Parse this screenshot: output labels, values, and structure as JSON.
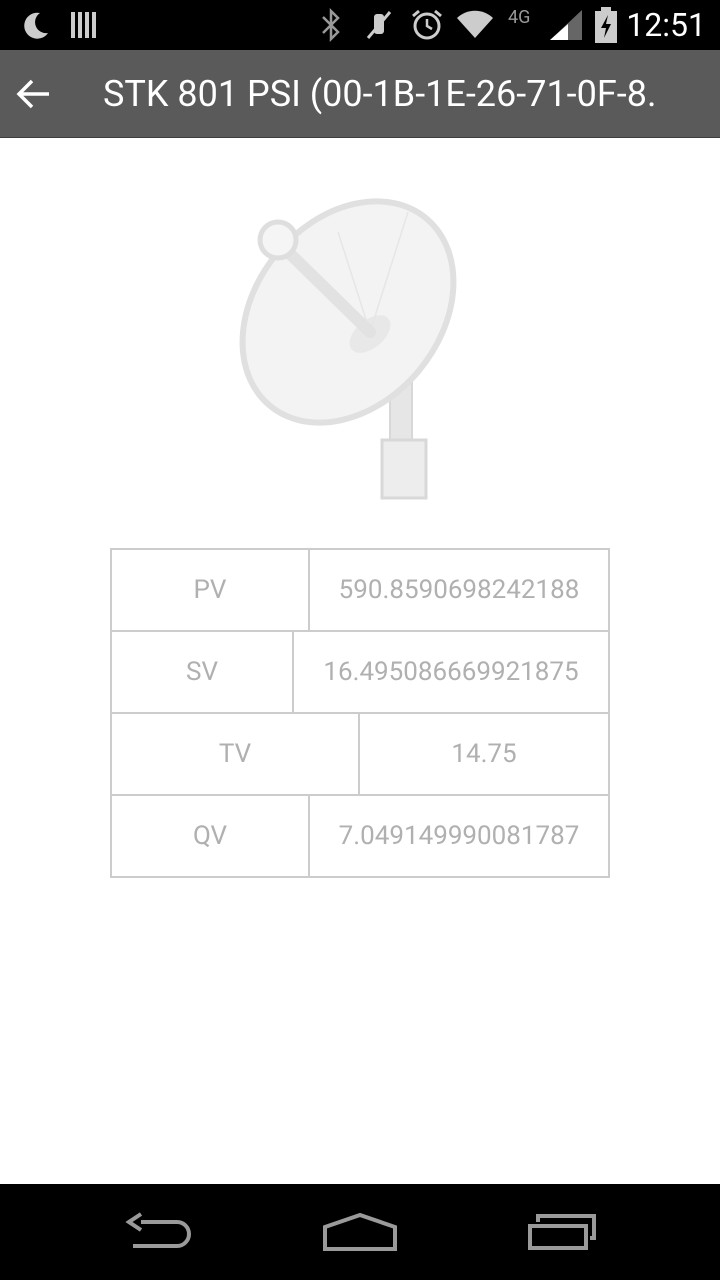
{
  "status_bar": {
    "time": "12:51",
    "network": "4G",
    "icons": [
      "moon-icon",
      "barcode-icon",
      "bluetooth-icon",
      "mute-icon",
      "alarm-icon",
      "wifi-icon",
      "signal-icon",
      "battery-charging-icon"
    ]
  },
  "action_bar": {
    "title": "STK 801 PSI (00-1B-1E-26-71-0F-8.",
    "back_icon": "arrow-left-icon"
  },
  "device_image": "satellite-dish-icon",
  "values": [
    {
      "label": "PV",
      "value": "590.8590698242188"
    },
    {
      "label": "SV",
      "value": "16.495086669921875"
    },
    {
      "label": "TV",
      "value": "14.75"
    },
    {
      "label": "QV",
      "value": "7.049149990081787"
    }
  ],
  "nav_bar": {
    "back": "nav-back-icon",
    "home": "nav-home-icon",
    "recents": "nav-recents-icon"
  }
}
